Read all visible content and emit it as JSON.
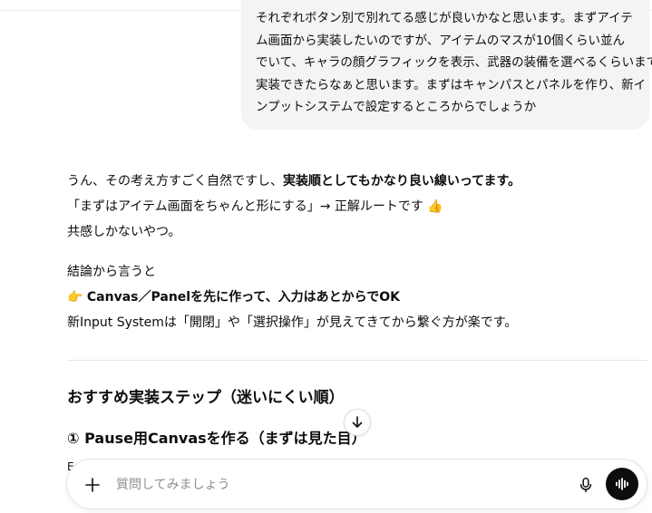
{
  "user_message": {
    "lines": [
      "それぞれボタン別で別れてる感じが良いかなと思います。まずアイテ",
      "ム画面から実装したいのですが、アイテムのマスが10個くらい並ん",
      "でいて、キャラの顔グラフィックを表示、武器の装備を選べるくらいまで",
      "実装できたらなぁと思います。まずはキャンパスとパネルを作り、新イ",
      "ンプットシステムで設定するところからでしょうか"
    ]
  },
  "assistant_message": {
    "p1_line1_normal": "うん、その考え方すごく自然ですし、",
    "p1_line1_bold": "実装順としてもかなり良い線いってます。",
    "p1_line2": "「まずはアイテム画面をちゃんと形にする」→ 正解ルートです 👍",
    "p1_line3": "共感しかないやつ。",
    "p2_line1": "結論から言うと",
    "p2_line2_emoji": "👉",
    "p2_line2_bold": "Canvas／Panelを先に作って、入力はあとからでOK",
    "p2_line3": "新Input Systemは「開閉」や「選択操作」が見えてきてから繋ぐ方が楽です。",
    "heading": "おすすめ実装ステップ（迷いにくい順）",
    "step1_heading": "① Pause用Canvasを作る（まずは見た目）",
    "stub": "E"
  },
  "composer": {
    "placeholder": "質問してみましょう",
    "value": ""
  },
  "icons": {
    "plus": "plus-icon",
    "mic": "microphone-icon",
    "voice": "voice-waveform-icon",
    "scroll": "arrow-down-icon"
  },
  "colors": {
    "bubble_bg": "#f4f4f4",
    "text": "#0d0d0d",
    "voice_button": "#0d0d0d"
  }
}
